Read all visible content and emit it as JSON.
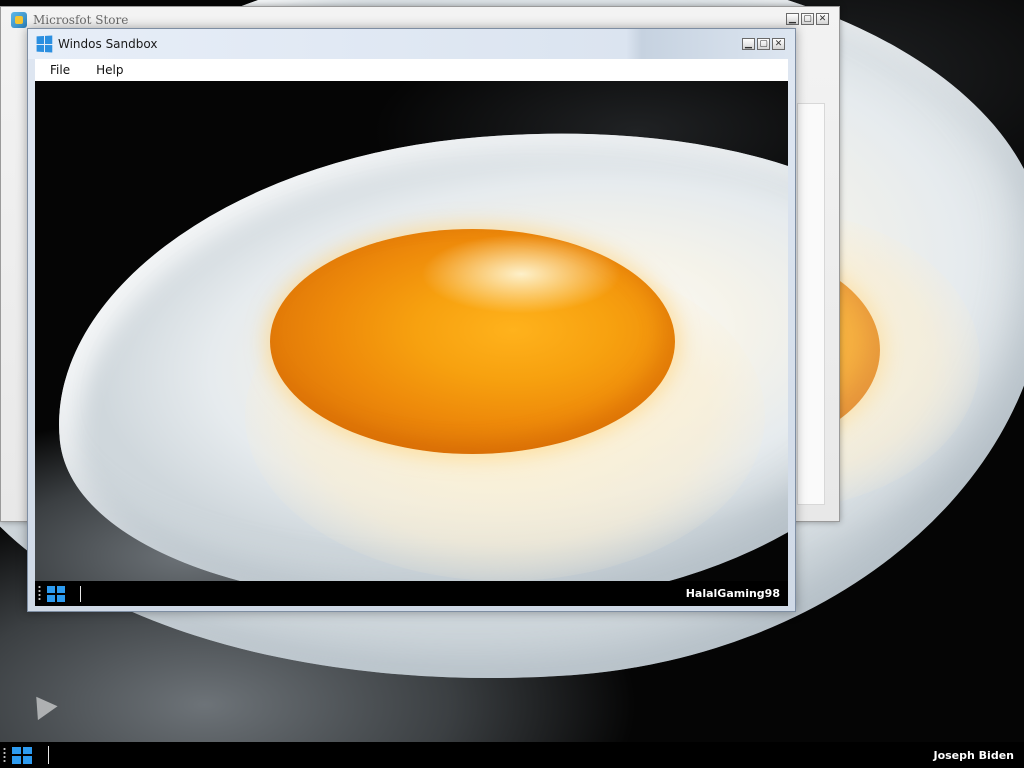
{
  "store_window": {
    "title": "Microsfot Store",
    "icon": "store-icon"
  },
  "sandbox_window": {
    "title": "Windos Sandbox",
    "icon": "windows-logo-icon",
    "menu": [
      {
        "label": "File"
      },
      {
        "label": "Help"
      }
    ],
    "taskbar": {
      "user": "HalalGaming98",
      "start_icon": "windows-start-icon"
    }
  },
  "window_controls": {
    "minimize": "minimize-icon",
    "maximize": "maximize-icon",
    "close": "close-icon"
  },
  "taskbar": {
    "user": "Joseph Biden",
    "start_icon": "windows-start-icon"
  },
  "wallpaper": {
    "subject": "fried-egg-image"
  },
  "colors": {
    "taskbar": "#000000",
    "start_icon": "#2d9bf0",
    "yolk": "#f7a10f"
  }
}
